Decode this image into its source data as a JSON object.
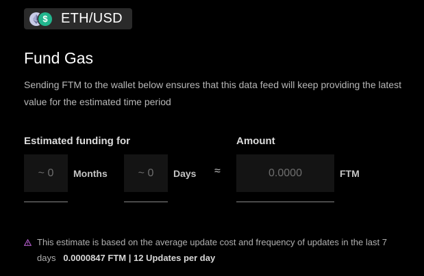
{
  "pair": {
    "label": "ETH/USD",
    "base_icon": "ethereum-icon",
    "quote_icon": "usd-dollar-icon",
    "usd_symbol": "$"
  },
  "title": "Fund Gas",
  "description": "Sending FTM to the wallet below ensures that this data feed will keep providing the latest value for the estimated time period",
  "estimate": {
    "label": "Estimated funding for",
    "months": {
      "placeholder": "~ 0",
      "unit": "Months"
    },
    "days": {
      "placeholder": "~ 0",
      "unit": "Days"
    },
    "approx_symbol": "≈"
  },
  "amount": {
    "label": "Amount",
    "placeholder": "0.0000",
    "unit": "FTM"
  },
  "note": {
    "icon": "warning-triangle-icon",
    "text_line1": "This estimate is based on the average update cost and frequency of updates in the last 7",
    "text_line2": "days",
    "cost": "0.0000847 FTM",
    "separator": "|",
    "frequency": "12 Updates per day"
  },
  "colors": {
    "background": "#000000",
    "usd_green": "#21b58d",
    "warning_purple": "#b05bc8"
  }
}
